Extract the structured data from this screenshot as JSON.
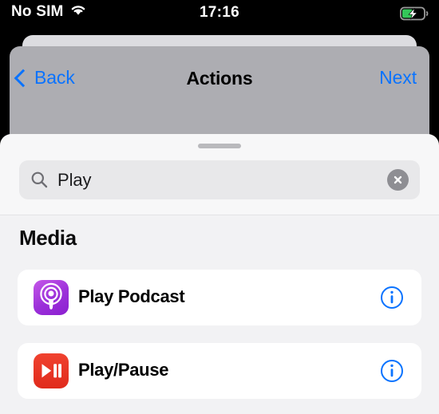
{
  "status_bar": {
    "carrier": "No SIM",
    "wifi_icon": "wifi-icon",
    "time": "17:16",
    "battery_icon": "battery-charging-icon",
    "battery_color": "#34c759"
  },
  "nav_bar": {
    "back_label": "Back",
    "back_icon": "chevron-left-icon",
    "title": "Actions",
    "next_label": "Next",
    "tint_color": "#0a73ff"
  },
  "sheet": {
    "grabber": "grabber-handle"
  },
  "search": {
    "icon": "search-icon",
    "value": "Play",
    "placeholder": "Search",
    "clear_icon": "clear-circle-icon"
  },
  "list": {
    "section_header": "Media",
    "rows": [
      {
        "label": "Play Podcast",
        "icon": "podcasts-app-icon",
        "icon_color": "#9b30d9",
        "info_icon": "info-circle-icon"
      },
      {
        "label": "Play/Pause",
        "icon": "play-pause-icon",
        "icon_color": "#e02b1c",
        "info_icon": "info-circle-icon"
      }
    ]
  }
}
